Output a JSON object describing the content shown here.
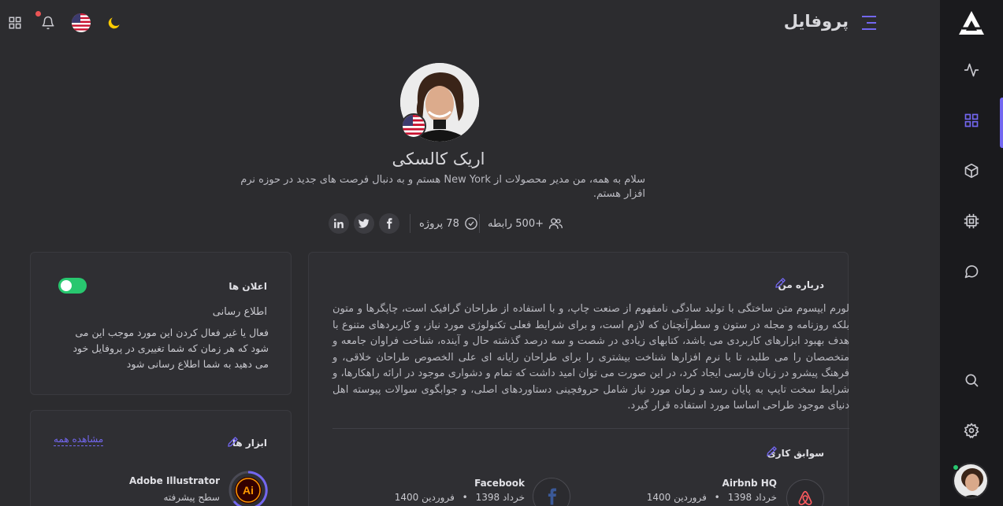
{
  "header": {
    "title": "پروفایل"
  },
  "profile": {
    "name": "اریک کالسکی",
    "bio": "سلام به همه، من مدیر محصولات از New York هستم و به دنبال فرصت های جدید در حوزه نرم افزار هستم.",
    "connections": "+500 رابطه",
    "projects": "78 پروژه",
    "social": [
      "in",
      "twitter",
      "facebook"
    ]
  },
  "notifications_card": {
    "title": "اعلان ها",
    "subtitle": "اطلاع رسانی",
    "description": "فعال یا غیر فعال کردن این مورد موجب این می شود که هر زمان که شما تغییری در پروفایل خود می دهید به شما اطلاع رسانی شود",
    "enabled": true
  },
  "tools_card": {
    "title": "ابزار ها",
    "view_all": "مشاهده همه",
    "tools": [
      {
        "name": "Adobe Illustrator",
        "level": "سطح پیشرفته",
        "icon_text": "Ai"
      }
    ]
  },
  "about_card": {
    "title": "درباره من",
    "text": "لورم ایپسوم متن ساختگی با تولید سادگی نامفهوم از صنعت چاپ، و با استفاده از طراحان گرافیک است، چاپگرها و متون بلکه روزنامه و مجله در ستون و سطرآنچنان که لازم است، و برای شرایط فعلی تکنولوژی مورد نیاز، و کاربردهای متنوع با هدف بهبود ابزارهای کاربردی می باشد، کتابهای زیادی در شصت و سه درصد گذشته حال و آینده، شناخت فراوان جامعه و متخصصان را می طلبد، تا با نرم افزارها شناخت بیشتری را برای طراحان رایانه ای علی الخصوص طراحان خلاقی، و فرهنگ پیشرو در زبان فارسی ایجاد کرد، در این صورت می توان امید داشت که تمام و دشواری موجود در ارائه راهکارها، و شرایط سخت تایپ به پایان رسد و زمان مورد نیاز شامل حروفچینی دستاوردهای اصلی، و جوابگوی سوالات پیوسته اهل دنیای موجود طراحی اساسا مورد استفاده قرار گیرد."
  },
  "experience": {
    "title": "سوابق کاری",
    "items": [
      {
        "company": "Airbnb HQ",
        "from": "خرداد 1398",
        "to": "فروردین 1400",
        "logo": "airbnb-icon"
      },
      {
        "company": "Facebook",
        "from": "خرداد 1398",
        "to": "فروردین 1400",
        "logo": "facebook-icon"
      }
    ],
    "bullet": "•"
  },
  "colors": {
    "accent": "#7367f0",
    "success": "#28c76f",
    "danger": "#ea5455",
    "sidebar_bg": "#1a1a1d",
    "page_bg": "#2c2c2f"
  }
}
